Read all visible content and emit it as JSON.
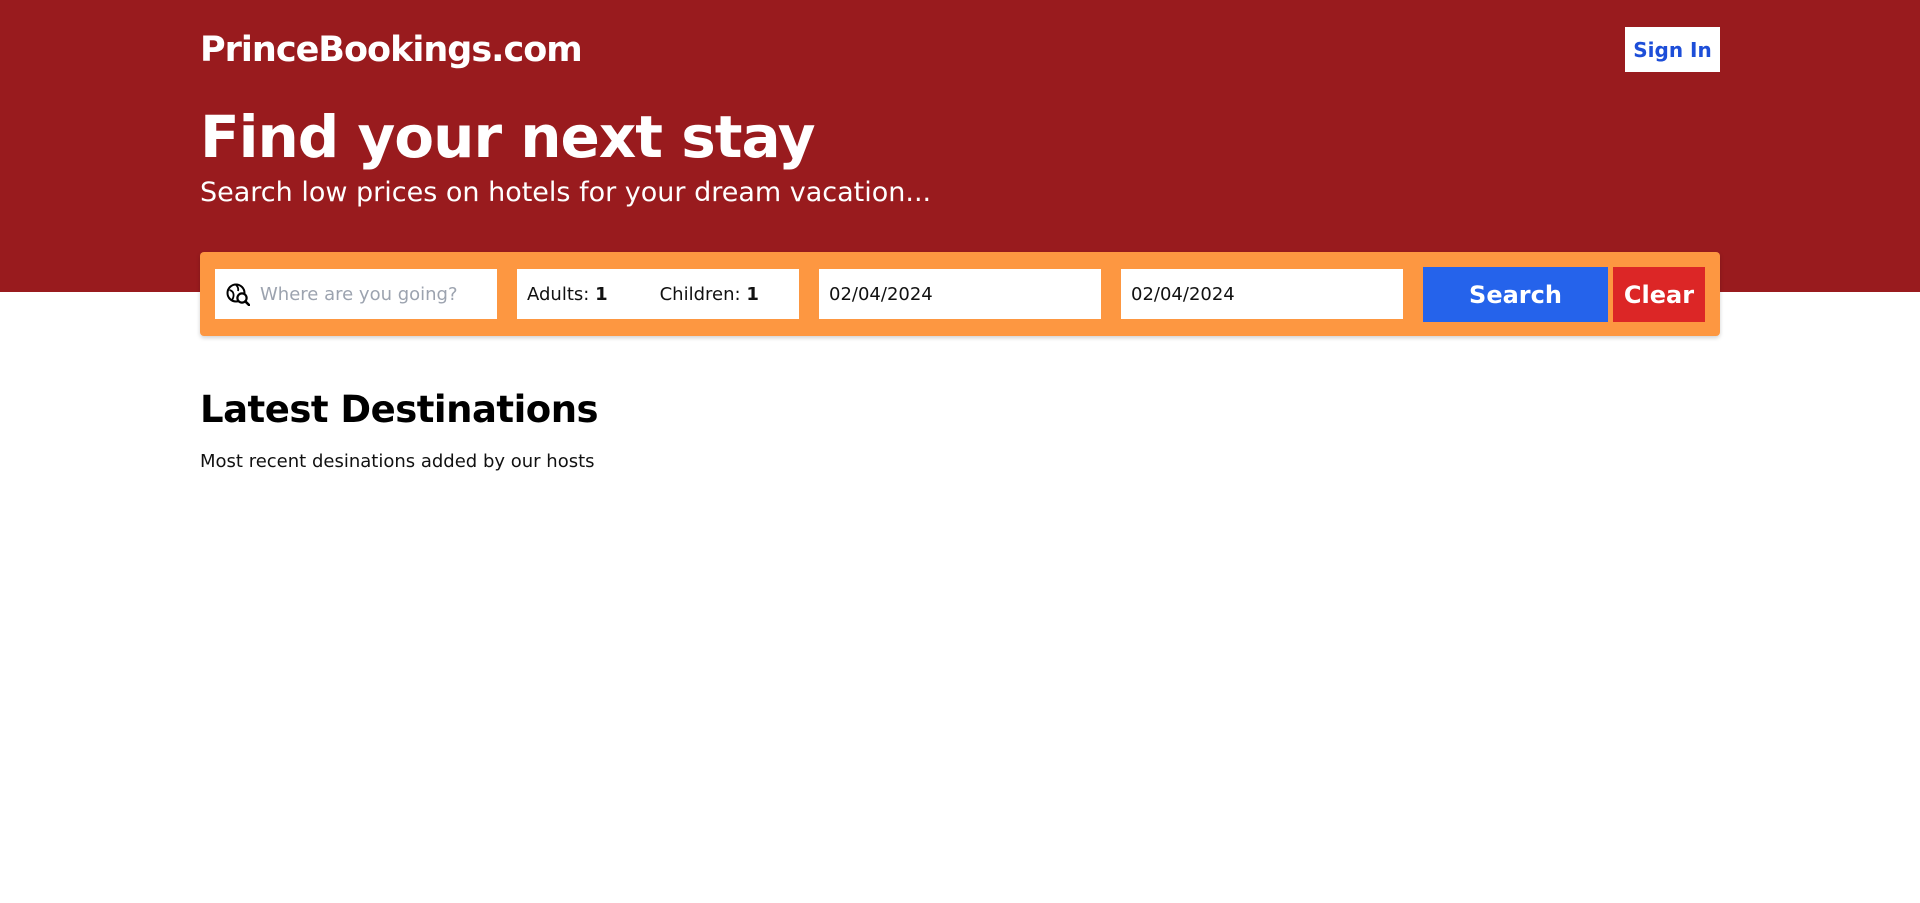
{
  "brand": {
    "logo": "PrinceBookings.com"
  },
  "header": {
    "signin_label": "Sign In"
  },
  "hero": {
    "title": "Find your next stay",
    "subtitle": "Search low prices on hotels for your dream vacation..."
  },
  "search": {
    "destination": {
      "placeholder": "Where are you going?",
      "value": "",
      "icon": "globe-search-icon"
    },
    "guests": {
      "adults_label": "Adults:",
      "adults_value": "1",
      "children_label": "Children:",
      "children_value": "1"
    },
    "check_in": {
      "value": "02/04/2024"
    },
    "check_out": {
      "value": "02/04/2024"
    },
    "search_button": "Search",
    "clear_button": "Clear"
  },
  "latest": {
    "title": "Latest Destinations",
    "subtitle": "Most recent desinations added by our hosts"
  },
  "colors": {
    "hero_bg": "#991b1e",
    "searchbar_bg": "#fd9741",
    "search_button": "#2563eb",
    "clear_button": "#dc2626",
    "signin_text": "#1d4ed8"
  }
}
